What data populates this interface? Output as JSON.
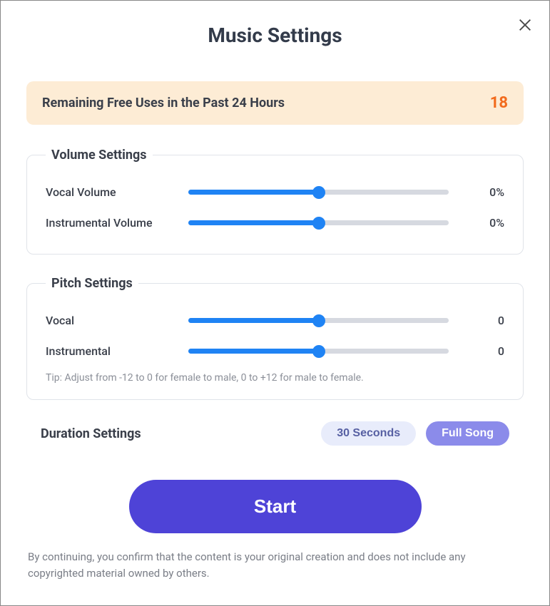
{
  "title": "Music Settings",
  "banner": {
    "label": "Remaining Free Uses in the Past 24 Hours",
    "value": "18"
  },
  "volume": {
    "legend": "Volume Settings",
    "vocal": {
      "label": "Vocal Volume",
      "value": "0%"
    },
    "instrumental": {
      "label": "Instrumental Volume",
      "value": "0%"
    }
  },
  "pitch": {
    "legend": "Pitch Settings",
    "vocal": {
      "label": "Vocal",
      "value": "0"
    },
    "instrumental": {
      "label": "Instrumental",
      "value": "0"
    },
    "tip": "Tip: Adjust from -12 to 0 for female to male, 0 to +12 for male to female."
  },
  "duration": {
    "label": "Duration Settings",
    "option1": "30 Seconds",
    "option2": "Full Song"
  },
  "start": "Start",
  "disclaimer": "By continuing, you confirm that the content is your original creation and does not include any copyrighted material owned by others."
}
